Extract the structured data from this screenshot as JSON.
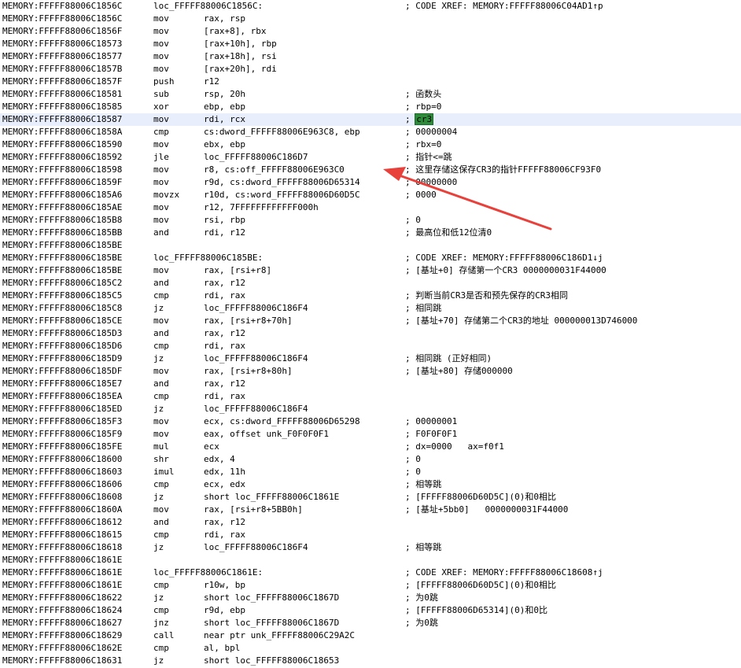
{
  "arrow_color": "#e8403a",
  "highlight_color": "#e8eefb",
  "lines": [
    {
      "addr": "MEMORY:FFFFF88006C1856C",
      "label": "loc_FFFFF88006C1856C:",
      "mn": "",
      "op": "",
      "cm": "; CODE XREF: MEMORY:FFFFF88006C04AD1↑p"
    },
    {
      "addr": "MEMORY:FFFFF88006C1856C",
      "mn": "mov",
      "op": "rax, rsp",
      "cm": ""
    },
    {
      "addr": "MEMORY:FFFFF88006C1856F",
      "mn": "mov",
      "op": "[rax+8], rbx",
      "cm": ""
    },
    {
      "addr": "MEMORY:FFFFF88006C18573",
      "mn": "mov",
      "op": "[rax+10h], rbp",
      "cm": ""
    },
    {
      "addr": "MEMORY:FFFFF88006C18577",
      "mn": "mov",
      "op": "[rax+18h], rsi",
      "cm": ""
    },
    {
      "addr": "MEMORY:FFFFF88006C1857B",
      "mn": "mov",
      "op": "[rax+20h], rdi",
      "cm": ""
    },
    {
      "addr": "MEMORY:FFFFF88006C1857F",
      "mn": "push",
      "op": "r12",
      "cm": ""
    },
    {
      "addr": "MEMORY:FFFFF88006C18581",
      "mn": "sub",
      "op": "rsp, 20h",
      "cm": "; 函数头"
    },
    {
      "addr": "MEMORY:FFFFF88006C18585",
      "mn": "xor",
      "op": "ebp, ebp",
      "cm": "; rbp=0"
    },
    {
      "addr": "MEMORY:FFFFF88006C18587",
      "mn": "mov",
      "op": "rdi, rcx",
      "cm": "; ",
      "cm_tag": "cr3",
      "hl": true
    },
    {
      "addr": "MEMORY:FFFFF88006C1858A",
      "mn": "cmp",
      "op": "cs:dword_FFFFF88006E963C8, ebp",
      "cm": "; 00000004"
    },
    {
      "addr": "MEMORY:FFFFF88006C18590",
      "mn": "mov",
      "op": "ebx, ebp",
      "cm": "; rbx=0"
    },
    {
      "addr": "MEMORY:FFFFF88006C18592",
      "mn": "jle",
      "op": "loc_FFFFF88006C186D7",
      "cm": "; 指针<=跳"
    },
    {
      "addr": "MEMORY:FFFFF88006C18598",
      "mn": "mov",
      "op": "r8, cs:off_FFFFF88006E963C0",
      "cm": "; 这里存储这保存CR3的指针FFFFF88006CF93F0"
    },
    {
      "addr": "MEMORY:FFFFF88006C1859F",
      "mn": "mov",
      "op": "r9d, cs:dword_FFFFF88006D65314",
      "cm": "; 00000000"
    },
    {
      "addr": "MEMORY:FFFFF88006C185A6",
      "mn": "movzx",
      "op": "r10d, cs:word_FFFFF88006D60D5C",
      "cm": "; 0000"
    },
    {
      "addr": "MEMORY:FFFFF88006C185AE",
      "mn": "mov",
      "op": "r12, 7FFFFFFFFFFFF000h",
      "cm": ""
    },
    {
      "addr": "MEMORY:FFFFF88006C185B8",
      "mn": "mov",
      "op": "rsi, rbp",
      "cm": "; 0"
    },
    {
      "addr": "MEMORY:FFFFF88006C185BB",
      "mn": "and",
      "op": "rdi, r12",
      "cm": "; 最高位和低12位清0"
    },
    {
      "addr": "MEMORY:FFFFF88006C185BE",
      "mn": "",
      "op": "",
      "cm": ""
    },
    {
      "addr": "MEMORY:FFFFF88006C185BE",
      "label": "loc_FFFFF88006C185BE:",
      "mn": "",
      "op": "",
      "cm": "; CODE XREF: MEMORY:FFFFF88006C186D1↓j"
    },
    {
      "addr": "MEMORY:FFFFF88006C185BE",
      "mn": "mov",
      "op": "rax, [rsi+r8]",
      "cm": "; [基址+0] 存储第一个CR3 0000000031F44000"
    },
    {
      "addr": "MEMORY:FFFFF88006C185C2",
      "mn": "and",
      "op": "rax, r12",
      "cm": ""
    },
    {
      "addr": "MEMORY:FFFFF88006C185C5",
      "mn": "cmp",
      "op": "rdi, rax",
      "cm": "; 判断当前CR3是否和预先保存的CR3相同"
    },
    {
      "addr": "MEMORY:FFFFF88006C185C8",
      "mn": "jz",
      "op": "loc_FFFFF88006C186F4",
      "cm": "; 相同跳"
    },
    {
      "addr": "MEMORY:FFFFF88006C185CE",
      "mn": "mov",
      "op": "rax, [rsi+r8+70h]",
      "cm": "; [基址+70] 存储第二个CR3的地址 000000013D746000"
    },
    {
      "addr": "MEMORY:FFFFF88006C185D3",
      "mn": "and",
      "op": "rax, r12",
      "cm": ""
    },
    {
      "addr": "MEMORY:FFFFF88006C185D6",
      "mn": "cmp",
      "op": "rdi, rax",
      "cm": ""
    },
    {
      "addr": "MEMORY:FFFFF88006C185D9",
      "mn": "jz",
      "op": "loc_FFFFF88006C186F4",
      "cm": "; 相同跳 (正好相同)"
    },
    {
      "addr": "MEMORY:FFFFF88006C185DF",
      "mn": "mov",
      "op": "rax, [rsi+r8+80h]",
      "cm": "; [基址+80] 存储000000"
    },
    {
      "addr": "MEMORY:FFFFF88006C185E7",
      "mn": "and",
      "op": "rax, r12",
      "cm": ""
    },
    {
      "addr": "MEMORY:FFFFF88006C185EA",
      "mn": "cmp",
      "op": "rdi, rax",
      "cm": ""
    },
    {
      "addr": "MEMORY:FFFFF88006C185ED",
      "mn": "jz",
      "op": "loc_FFFFF88006C186F4",
      "cm": ""
    },
    {
      "addr": "MEMORY:FFFFF88006C185F3",
      "mn": "mov",
      "op": "ecx, cs:dword_FFFFF88006D65298",
      "cm": "; 00000001"
    },
    {
      "addr": "MEMORY:FFFFF88006C185F9",
      "mn": "mov",
      "op": "eax, offset unk_F0F0F0F1",
      "cm": "; F0F0F0F1"
    },
    {
      "addr": "MEMORY:FFFFF88006C185FE",
      "mn": "mul",
      "op": "ecx",
      "cm": "; dx=0000   ax=f0f1"
    },
    {
      "addr": "MEMORY:FFFFF88006C18600",
      "mn": "shr",
      "op": "edx, 4",
      "cm": "; 0"
    },
    {
      "addr": "MEMORY:FFFFF88006C18603",
      "mn": "imul",
      "op": "edx, 11h",
      "cm": "; 0"
    },
    {
      "addr": "MEMORY:FFFFF88006C18606",
      "mn": "cmp",
      "op": "ecx, edx",
      "cm": "; 相等跳"
    },
    {
      "addr": "MEMORY:FFFFF88006C18608",
      "mn": "jz",
      "op": "short loc_FFFFF88006C1861E",
      "cm": "; [FFFFF88006D60D5C](0)和0相比"
    },
    {
      "addr": "MEMORY:FFFFF88006C1860A",
      "mn": "mov",
      "op": "rax, [rsi+r8+5BB0h]",
      "cm": "; [基址+5bb0]   0000000031F44000"
    },
    {
      "addr": "MEMORY:FFFFF88006C18612",
      "mn": "and",
      "op": "rax, r12",
      "cm": ""
    },
    {
      "addr": "MEMORY:FFFFF88006C18615",
      "mn": "cmp",
      "op": "rdi, rax",
      "cm": ""
    },
    {
      "addr": "MEMORY:FFFFF88006C18618",
      "mn": "jz",
      "op": "loc_FFFFF88006C186F4",
      "cm": "; 相等跳"
    },
    {
      "addr": "MEMORY:FFFFF88006C1861E",
      "mn": "",
      "op": "",
      "cm": ""
    },
    {
      "addr": "MEMORY:FFFFF88006C1861E",
      "label": "loc_FFFFF88006C1861E:",
      "mn": "",
      "op": "",
      "cm": "; CODE XREF: MEMORY:FFFFF88006C18608↑j"
    },
    {
      "addr": "MEMORY:FFFFF88006C1861E",
      "mn": "cmp",
      "op": "r10w, bp",
      "cm": "; [FFFFF88006D60D5C](0)和0相比"
    },
    {
      "addr": "MEMORY:FFFFF88006C18622",
      "mn": "jz",
      "op": "short loc_FFFFF88006C1867D",
      "cm": "; 为0跳"
    },
    {
      "addr": "MEMORY:FFFFF88006C18624",
      "mn": "cmp",
      "op": "r9d, ebp",
      "cm": "; [FFFFF88006D65314](0)和0比"
    },
    {
      "addr": "MEMORY:FFFFF88006C18627",
      "mn": "jnz",
      "op": "short loc_FFFFF88006C1867D",
      "cm": "; 为0跳"
    },
    {
      "addr": "MEMORY:FFFFF88006C18629",
      "mn": "call",
      "op": "near ptr unk_FFFFF88006C29A2C",
      "cm": ""
    },
    {
      "addr": "MEMORY:FFFFF88006C1862E",
      "mn": "cmp",
      "op": "al, bpl",
      "cm": ""
    },
    {
      "addr": "MEMORY:FFFFF88006C18631",
      "mn": "jz",
      "op": "short loc_FFFFF88006C18653",
      "cm": ""
    }
  ]
}
